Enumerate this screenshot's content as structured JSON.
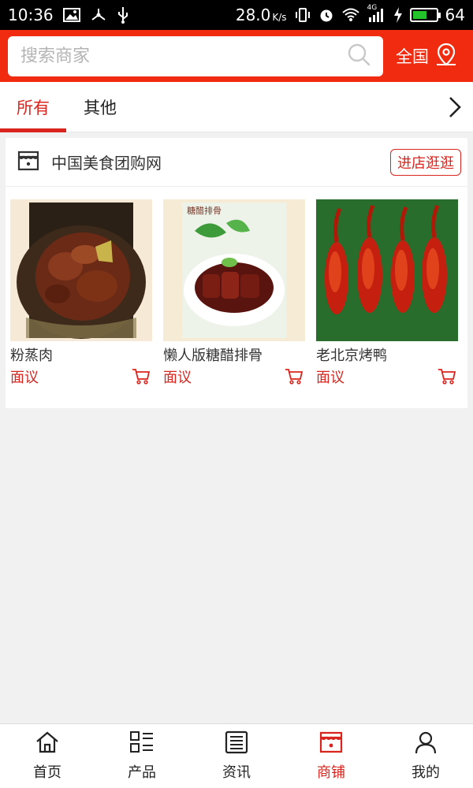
{
  "status_bar": {
    "time": "10:36",
    "speed": "28.0",
    "speed_unit": "K/s",
    "network": "4G",
    "battery_level": "64",
    "icons": [
      "image-icon",
      "share-icon",
      "usb-icon",
      "vibrate-icon",
      "alarm-icon",
      "wifi-icon",
      "signal-icon",
      "charging-icon",
      "battery-icon"
    ]
  },
  "search": {
    "placeholder": "搜索商家",
    "region_label": "全国"
  },
  "tabs": [
    {
      "label": "所有",
      "active": true
    },
    {
      "label": "其他",
      "active": false
    }
  ],
  "store": {
    "name": "中国美食团购网",
    "visit_label": "进店逛逛",
    "products": [
      {
        "name": "粉蒸肉",
        "price": "面议"
      },
      {
        "name": "懒人版糖醋排骨",
        "price": "面议",
        "image_caption": "糖醋排骨"
      },
      {
        "name": "老北京烤鸭",
        "price": "面议"
      }
    ]
  },
  "bottom_nav": [
    {
      "label": "首页",
      "icon": "home-icon",
      "active": false
    },
    {
      "label": "产品",
      "icon": "grid-list-icon",
      "active": false
    },
    {
      "label": "资讯",
      "icon": "news-icon",
      "active": false
    },
    {
      "label": "商铺",
      "icon": "store-icon",
      "active": true
    },
    {
      "label": "我的",
      "icon": "user-icon",
      "active": false
    }
  ],
  "colors": {
    "brand_red": "#f02b0f",
    "accent_red": "#d9251d",
    "background": "#f1f1f1"
  }
}
